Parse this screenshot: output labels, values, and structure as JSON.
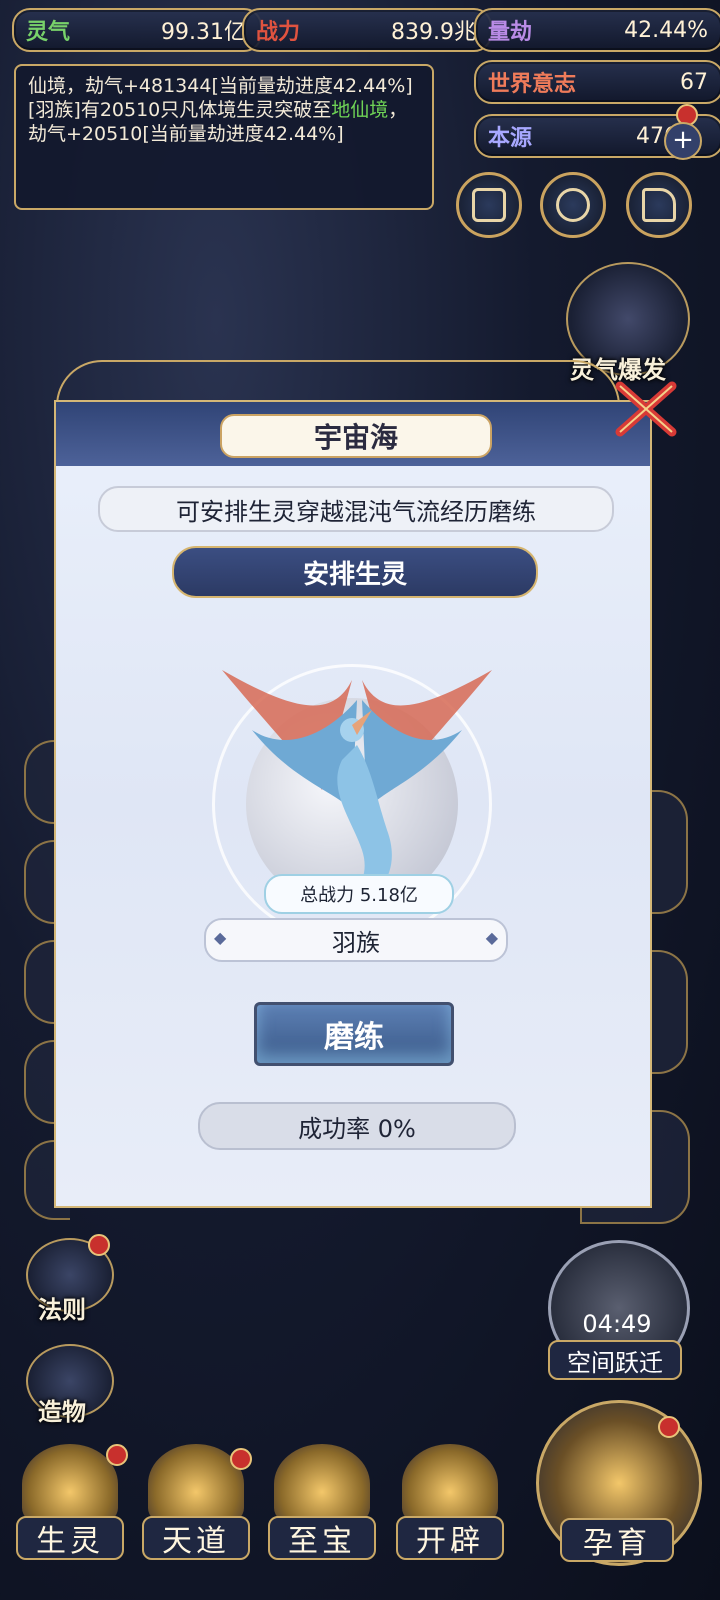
{
  "stats": {
    "lingqi": {
      "label": "灵气",
      "value": "99.31亿"
    },
    "zhanli": {
      "label": "战力",
      "value": "839.9兆"
    },
    "liangjie": {
      "label": "量劫",
      "value": "42.44%"
    },
    "shijie": {
      "label": "世界意志",
      "value": "67"
    },
    "benyuan": {
      "label": "本源",
      "value": "476"
    }
  },
  "log": {
    "line1": "仙境，劫气+481344[当前量劫进度42.44%]",
    "line2_prefix": "[羽族]有20510只凡体境生灵突破至",
    "line2_highlight": "地仙境",
    "line2_suffix": "，劫气+20510[当前量劫进度42.44%]"
  },
  "right_panel": {
    "burst_label": "灵气爆发",
    "space_jump_label": "空间跃迁",
    "timer": "04:49"
  },
  "left_panel": {
    "fa_ze": "法则",
    "zao_wu": "造物"
  },
  "modal": {
    "title": "宇宙海",
    "description": "可安排生灵穿越混沌气流经历磨练",
    "arrange_label": "安排生灵",
    "power_label": "总战力 5.18亿",
    "race": "羽族",
    "train_label": "磨练",
    "success_rate": "成功率 0%"
  },
  "nav": [
    "生灵",
    "天道",
    "至宝",
    "开辟",
    "孕育"
  ]
}
